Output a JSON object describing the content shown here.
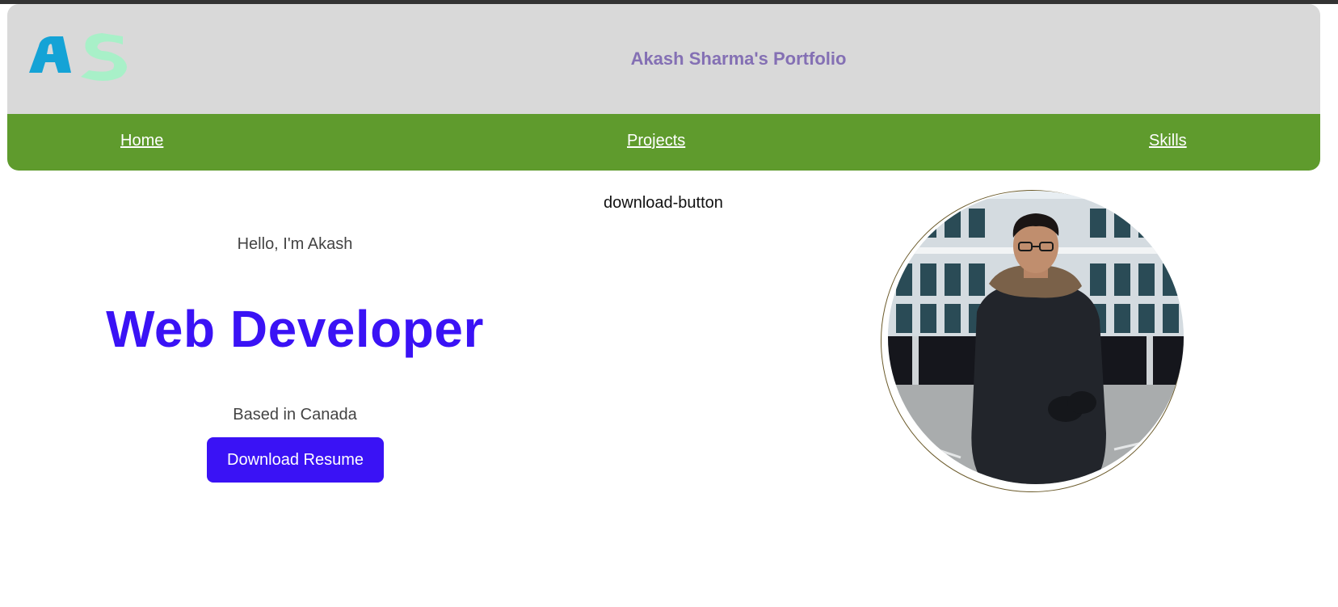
{
  "header": {
    "logo_alt": "AS",
    "title": "Akash Sharma's Portfolio"
  },
  "nav": {
    "items": [
      {
        "label": "Home"
      },
      {
        "label": "Projects"
      },
      {
        "label": "Skills"
      }
    ]
  },
  "hover_label": "download-button",
  "hero": {
    "greeting": "Hello, I'm Akash",
    "role": "Web Developer",
    "location": "Based in Canada",
    "button_label": "Download Resume"
  },
  "colors": {
    "header_bg": "#d9d9d9",
    "nav_bg": "#5f9b2d",
    "title": "#8470b4",
    "accent": "#3a12f5",
    "logo_a": "#14a3d6",
    "logo_s": "#a8f0c8"
  },
  "photo": {
    "icon": "profile-photo"
  }
}
